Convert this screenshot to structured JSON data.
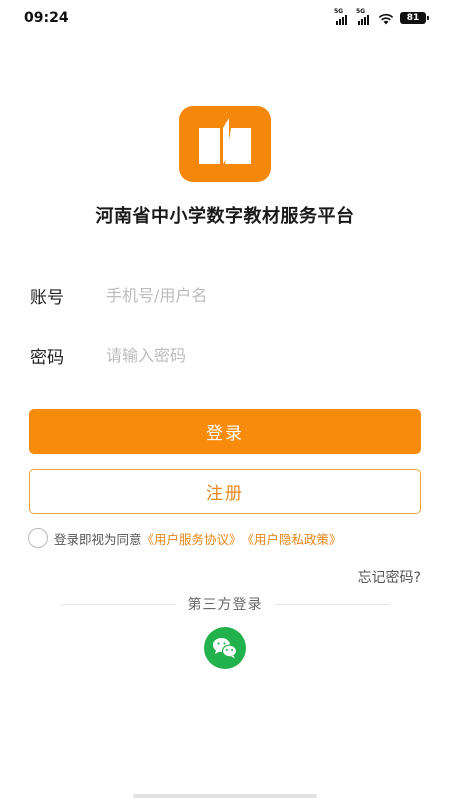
{
  "status_bar": {
    "time": "09:24",
    "signal_1_label": "5G",
    "signal_2_label": "5G",
    "battery_level": "81",
    "icons": [
      "signal-icon",
      "signal-icon",
      "wifi-icon",
      "battery-icon"
    ]
  },
  "app": {
    "logo_icon": "book-icon",
    "title": "河南省中小学数字教材服务平台",
    "brand_color": "#F98B0C"
  },
  "form": {
    "account_label": "账号",
    "account_placeholder": "手机号/用户名",
    "account_value": "",
    "password_label": "密码",
    "password_placeholder": "请输入密码",
    "password_value": ""
  },
  "buttons": {
    "login_label": "登录",
    "register_label": "注册"
  },
  "agreement": {
    "prefix": "登录即视为同意",
    "service_link": "《用户服务协议》",
    "privacy_link": "《用户隐私政策》",
    "checked": false
  },
  "forgot_password": "忘记密码?",
  "third_party": {
    "label": "第三方登录",
    "providers": [
      {
        "name": "wechat",
        "icon": "wechat-icon",
        "color": "#21B24D"
      }
    ]
  }
}
